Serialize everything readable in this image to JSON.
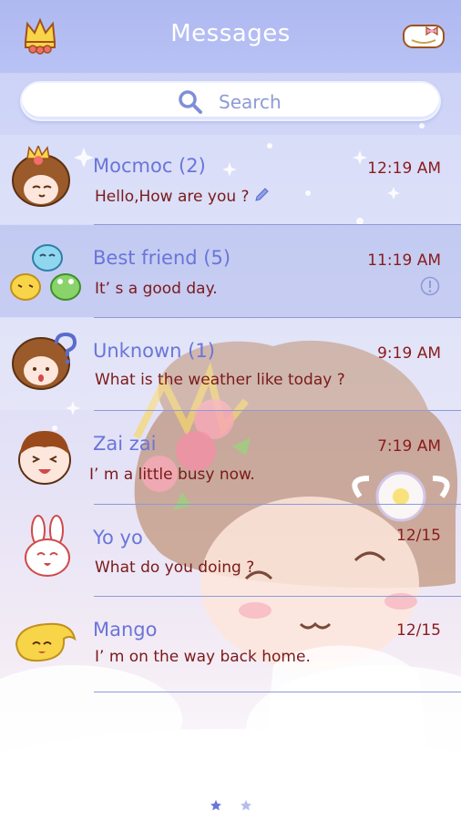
{
  "header": {
    "title": "Messages",
    "left_icon": "crown-icon",
    "right_icon": "bow-icon"
  },
  "search": {
    "label": "Search"
  },
  "threads": [
    {
      "name": "Mocmoc (2)",
      "time": "12:19 AM",
      "preview": "Hello,How are you ?",
      "status_icon": "pencil-icon"
    },
    {
      "name": "Best friend (5)",
      "time": "11:19 AM",
      "preview": "It’ s a good day.",
      "status_icon": "alert-icon"
    },
    {
      "name": "Unknown (1)",
      "time": "9:19 AM",
      "preview": "What is the weather like today ?"
    },
    {
      "name": "Zai zai",
      "time": "7:19 AM",
      "preview": "I’ m a little busy now."
    },
    {
      "name": "Yo yo",
      "time": "12/15",
      "preview": "What do you doing ?"
    },
    {
      "name": "Mango",
      "time": "12/15",
      "preview": "I’ m on the way back home."
    }
  ],
  "pager": {
    "pages": 2,
    "current": 1
  },
  "colors": {
    "header": "#aeb9f1",
    "name": "#6a75d8",
    "time": "#8a1b1b",
    "preview": "#7a1a1a"
  }
}
